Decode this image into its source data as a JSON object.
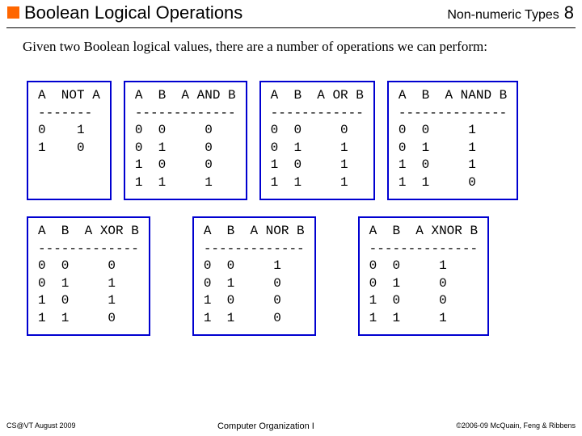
{
  "header": {
    "title": "Boolean Logical Operations",
    "label": "Non-numeric Types",
    "pageno": "8"
  },
  "intro": "Given two Boolean logical values, there are a number of operations we can perform:",
  "tables": {
    "not": "A  NOT A\n-------\n0    1\n1    0",
    "and": "A  B  A AND B\n-------------\n0  0     0\n0  1     0\n1  0     0\n1  1     1",
    "or": "A  B  A OR B\n------------\n0  0     0\n0  1     1\n1  0     1\n1  1     1",
    "nand": "A  B  A NAND B\n--------------\n0  0     1\n0  1     1\n1  0     1\n1  1     0",
    "xor": "A  B  A XOR B\n-------------\n0  0     0\n0  1     1\n1  0     1\n1  1     0",
    "nor": "A  B  A NOR B\n-------------\n0  0     1\n0  1     0\n1  0     0\n1  1     0",
    "xnor": "A  B  A XNOR B\n--------------\n0  0     1\n0  1     0\n1  0     0\n1  1     1"
  },
  "footer": {
    "left": "CS@VT August 2009",
    "center": "Computer Organization I",
    "right": "©2006-09  McQuain, Feng & Ribbens"
  },
  "chart_data": [
    {
      "type": "table",
      "title": "NOT",
      "columns": [
        "A",
        "NOT A"
      ],
      "rows": [
        [
          0,
          1
        ],
        [
          1,
          0
        ]
      ]
    },
    {
      "type": "table",
      "title": "AND",
      "columns": [
        "A",
        "B",
        "A AND B"
      ],
      "rows": [
        [
          0,
          0,
          0
        ],
        [
          0,
          1,
          0
        ],
        [
          1,
          0,
          0
        ],
        [
          1,
          1,
          1
        ]
      ]
    },
    {
      "type": "table",
      "title": "OR",
      "columns": [
        "A",
        "B",
        "A OR B"
      ],
      "rows": [
        [
          0,
          0,
          0
        ],
        [
          0,
          1,
          1
        ],
        [
          1,
          0,
          1
        ],
        [
          1,
          1,
          1
        ]
      ]
    },
    {
      "type": "table",
      "title": "NAND",
      "columns": [
        "A",
        "B",
        "A NAND B"
      ],
      "rows": [
        [
          0,
          0,
          1
        ],
        [
          0,
          1,
          1
        ],
        [
          1,
          0,
          1
        ],
        [
          1,
          1,
          0
        ]
      ]
    },
    {
      "type": "table",
      "title": "XOR",
      "columns": [
        "A",
        "B",
        "A XOR B"
      ],
      "rows": [
        [
          0,
          0,
          0
        ],
        [
          0,
          1,
          1
        ],
        [
          1,
          0,
          1
        ],
        [
          1,
          1,
          0
        ]
      ]
    },
    {
      "type": "table",
      "title": "NOR",
      "columns": [
        "A",
        "B",
        "A NOR B"
      ],
      "rows": [
        [
          0,
          0,
          1
        ],
        [
          0,
          1,
          0
        ],
        [
          1,
          0,
          0
        ],
        [
          1,
          1,
          0
        ]
      ]
    },
    {
      "type": "table",
      "title": "XNOR",
      "columns": [
        "A",
        "B",
        "A XNOR B"
      ],
      "rows": [
        [
          0,
          0,
          1
        ],
        [
          0,
          1,
          0
        ],
        [
          1,
          0,
          0
        ],
        [
          1,
          1,
          1
        ]
      ]
    }
  ]
}
